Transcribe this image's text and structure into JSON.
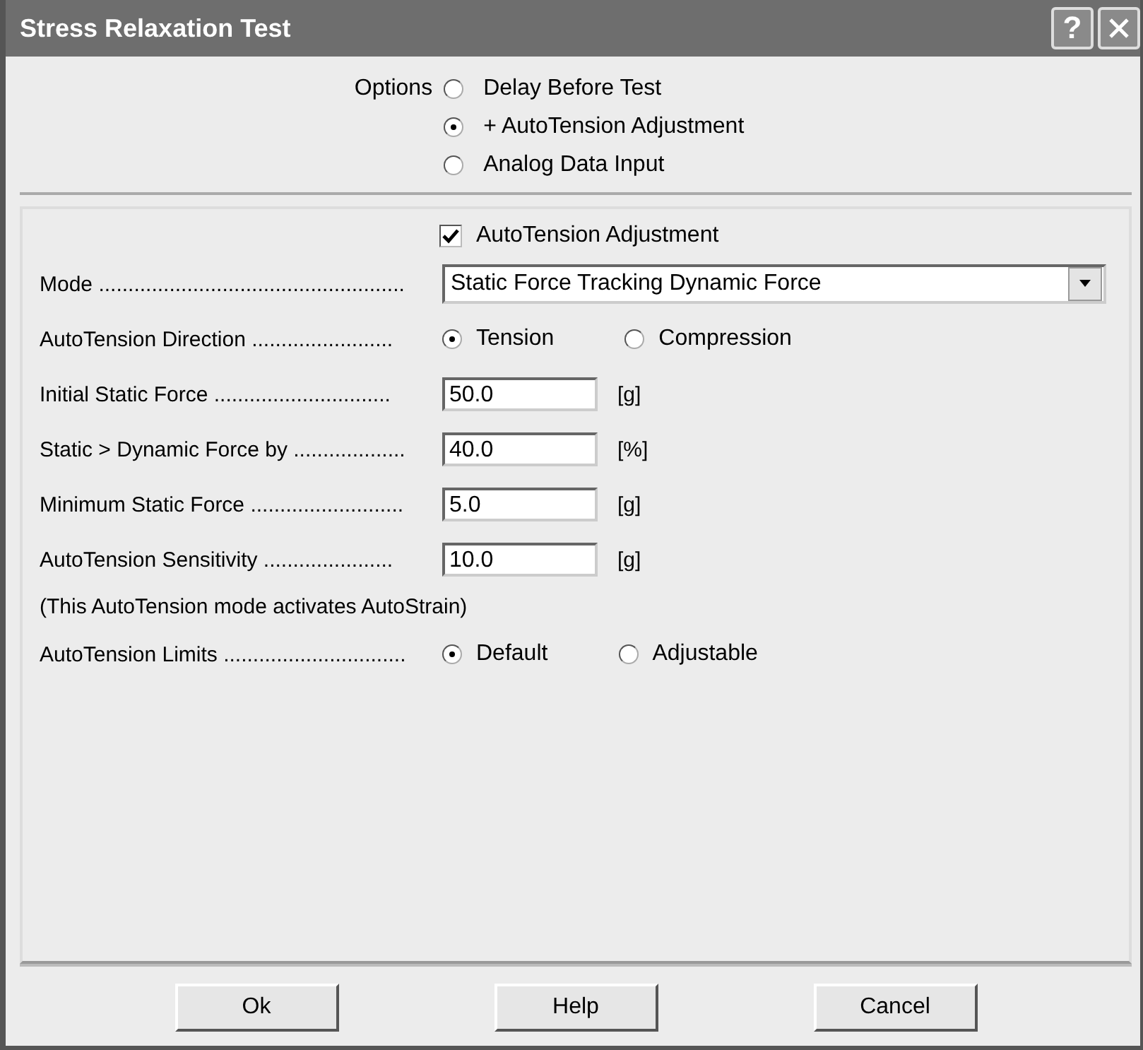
{
  "window": {
    "title": "Stress Relaxation Test",
    "help_button": "?"
  },
  "options": {
    "label": "Options",
    "items": [
      {
        "label": "Delay Before Test",
        "selected": false
      },
      {
        "label": "+ AutoTension Adjustment",
        "selected": true
      },
      {
        "label": "Analog Data Input",
        "selected": false
      }
    ]
  },
  "autotension": {
    "label": "AutoTension Adjustment",
    "checked": true
  },
  "rows": [
    {
      "kind": "select",
      "label": "Mode ....................................................",
      "value": "Static Force Tracking Dynamic Force"
    },
    {
      "kind": "radio",
      "label": "AutoTension Direction ........................",
      "options": [
        {
          "label": "Tension",
          "selected": true
        },
        {
          "label": "Compression",
          "selected": false
        }
      ]
    },
    {
      "kind": "field",
      "label": "Initial Static Force ..............................",
      "value": "50.0",
      "unit": "[g]"
    },
    {
      "kind": "field",
      "label": "Static > Dynamic Force by ...................",
      "value": "40.0",
      "unit": "[%]"
    },
    {
      "kind": "field",
      "label": "Minimum Static Force ..........................",
      "value": "5.0",
      "unit": "[g]"
    },
    {
      "kind": "field",
      "label": "AutoTension Sensitivity ......................",
      "value": "10.0",
      "unit": "[g]"
    },
    {
      "kind": "note",
      "label": "(This AutoTension mode activates AutoStrain)"
    },
    {
      "kind": "radio",
      "label": "AutoTension Limits ...............................",
      "options": [
        {
          "label": "Default",
          "selected": true
        },
        {
          "label": "Adjustable",
          "selected": false
        }
      ]
    }
  ],
  "buttons": [
    "Ok",
    "Help",
    "Cancel"
  ]
}
